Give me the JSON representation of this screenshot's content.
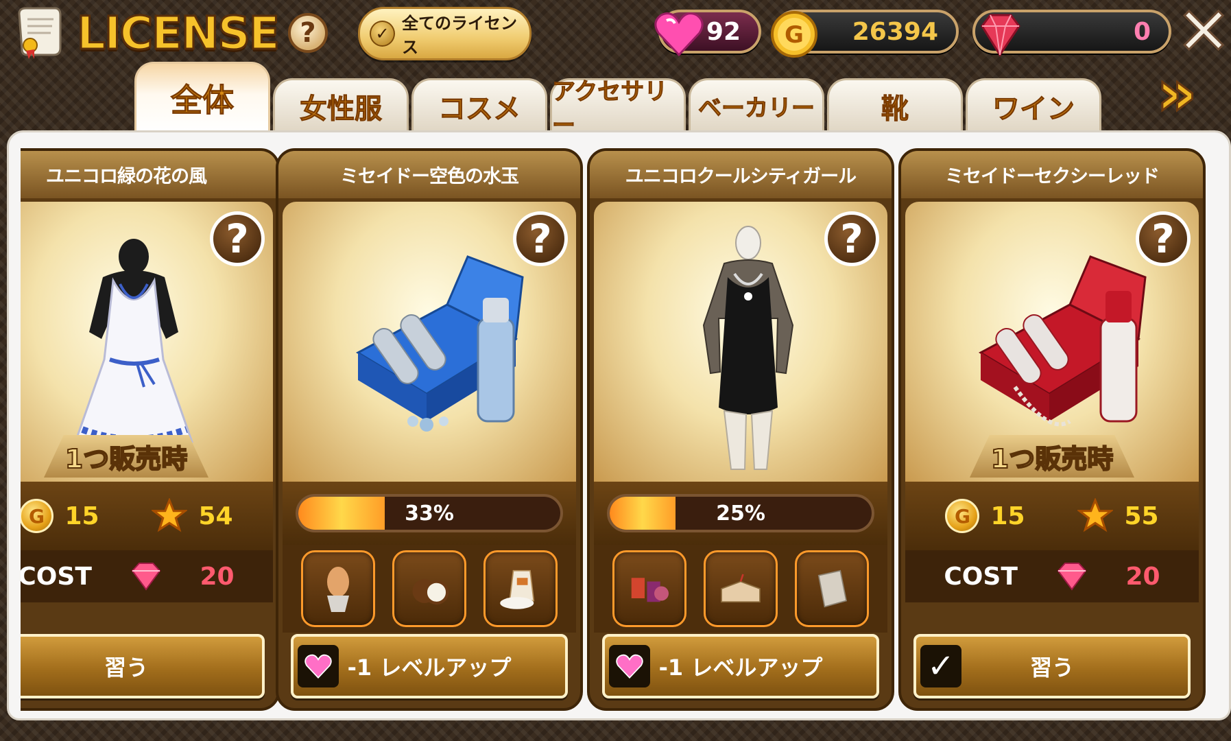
{
  "header": {
    "title": "LICENSE",
    "all_license_label": "全てのライセンス",
    "help_symbol": "?",
    "close_symbol": "✕"
  },
  "currencies": {
    "hearts": "92",
    "gold": "26394",
    "gems": "0"
  },
  "tabs": [
    {
      "label": "全体",
      "active": true
    },
    {
      "label": "女性服"
    },
    {
      "label": "コスメ"
    },
    {
      "label": "アクセサリー"
    },
    {
      "label": "ベーカリー"
    },
    {
      "label": "靴"
    },
    {
      "label": "ワイン"
    }
  ],
  "tabs_next_symbol": "»",
  "cards": [
    {
      "name": "ユニコロ緑の花の風",
      "sell_label": "1つ販売時",
      "gold": "15",
      "stars": "54",
      "cost_label": "COST",
      "cost": "20",
      "action_label": "習う"
    },
    {
      "name": "ミセイドー空色の水玉",
      "progress_text": "33%",
      "progress": 0.33,
      "action_label": "-1 レベルアップ"
    },
    {
      "name": "ユニコロクールシティガール",
      "progress_text": "25%",
      "progress": 0.25,
      "action_label": "-1 レベルアップ"
    },
    {
      "name": "ミセイドーセクシーレッド",
      "sell_label": "1つ販売時",
      "gold": "15",
      "stars": "55",
      "cost_label": "COST",
      "cost": "20",
      "action_label": "習う"
    }
  ],
  "colors": {
    "accent_gold": "#f6c22b",
    "cost_red": "#ff5a6e",
    "stat_yellow": "#ffd429"
  }
}
